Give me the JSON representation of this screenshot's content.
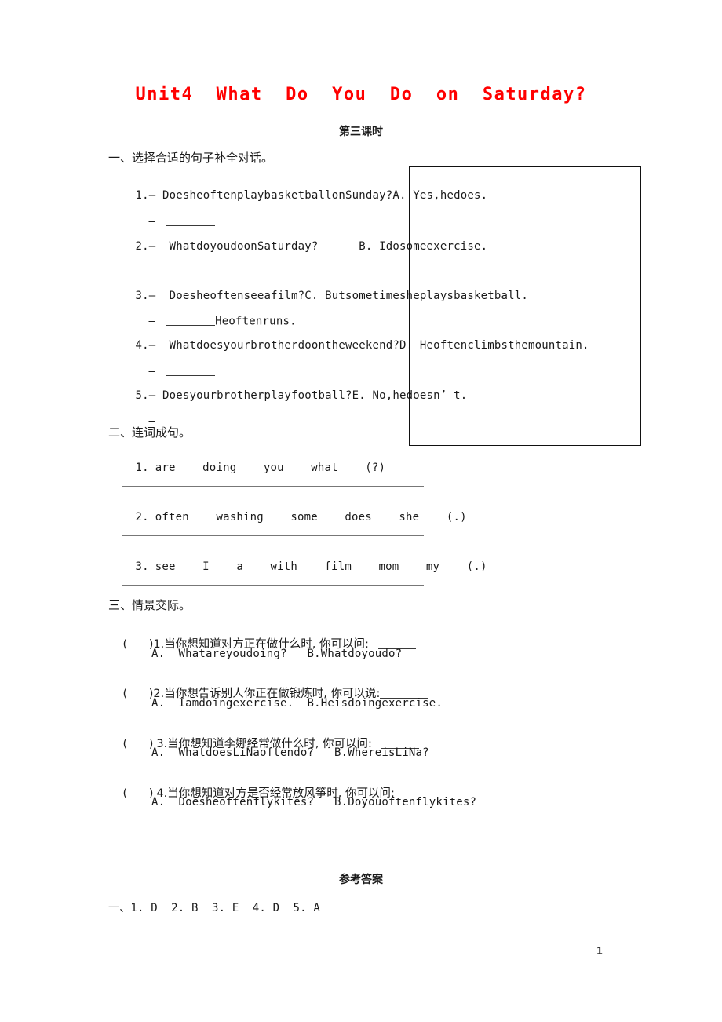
{
  "document": {
    "title": "Unit4  What  Do  You  Do  on  Saturday?",
    "subtitle": "第三课时",
    "page_number": "1",
    "title_color": "#ff0000",
    "text_color": "#1a1a1a"
  },
  "section1": {
    "heading": "一、选择合适的句子补全对话。",
    "items": [
      {
        "number": "1.",
        "prompt": "— DoesheoftenplaybasketballonSunday?A. Yes,hedoes.",
        "answer_dash": "—",
        "answer_suffix": ""
      },
      {
        "number": "2.",
        "prompt": "—  WhatdoyoudoonSaturday?      B. Idosomeexercise.",
        "answer_dash": "—",
        "answer_suffix": ""
      },
      {
        "number": "3.",
        "prompt": "—  Doesheoftenseeafilm?C. Butsometimesheplaysbasketball.",
        "answer_dash": "—",
        "answer_suffix": "Heoftenruns."
      },
      {
        "number": "4.",
        "prompt": "—  Whatdoesyourbrotherdoontheweekend?D. Heoftenclimbsthemountain.",
        "answer_dash": "—",
        "answer_suffix": ""
      },
      {
        "number": "5.",
        "prompt": "— Doesyourbrotherplayfootball?E. No,hedoesn’ t.",
        "answer_dash": "—",
        "answer_suffix": ""
      }
    ]
  },
  "section2": {
    "heading": "二、连词成句。",
    "items": [
      {
        "number": "1.",
        "words": "are    doing    you    what    (?)"
      },
      {
        "number": "2.",
        "words": "often    washing    some    does    she    (.)"
      },
      {
        "number": "3.",
        "words": "see    I    a    with    film    mom    my    (.)"
      }
    ]
  },
  "section3": {
    "heading": "三、情景交际。",
    "items": [
      {
        "bracket": "(      )",
        "number": "1.",
        "question": "当你想知道对方正在做什么时, 你可以问:",
        "options": "A.  Whatareyoudoing?   B.Whatdoyoudo?"
      },
      {
        "bracket": "(      )",
        "number": "2.",
        "question": "当你想告诉别人你正在做锻炼时, 你可以说:",
        "options": "A.  Iamdoingexercise.  B.Heisdoingexercise."
      },
      {
        "bracket": "(      )",
        "number": "3.",
        "question": "当你想知道李娜经常做什么时, 你可以问:",
        "options": "A.  WhatdoesLiNaoftendo?   B.WhereisLiNa?"
      },
      {
        "bracket": "(      )",
        "number": "4.",
        "question": "当你想知道对方是否经常放风筝时, 你可以问:",
        "options": "A.  Doesheoftenflykites?   B.Doyouoftenflykites?"
      }
    ]
  },
  "answers": {
    "title": "参考答案",
    "lines": [
      "一、1. D  2. B  3. E  4. D  5. A"
    ]
  }
}
